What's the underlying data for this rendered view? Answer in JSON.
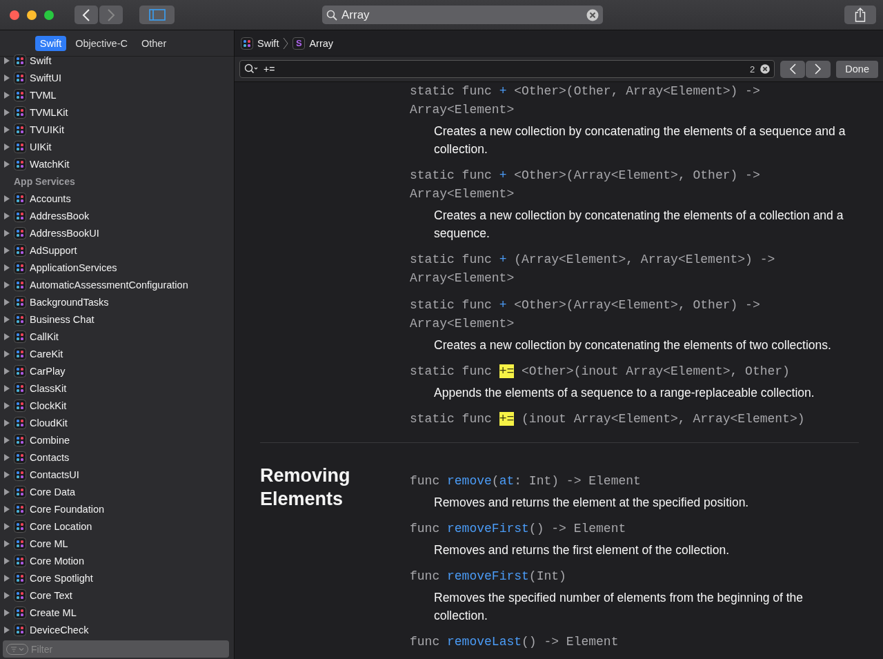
{
  "toolbar": {
    "search": {
      "value": "Array"
    }
  },
  "language_tabs": [
    {
      "label": "Swift",
      "selected": true
    },
    {
      "label": "Objective-C",
      "selected": false
    },
    {
      "label": "Other",
      "selected": false
    }
  ],
  "sidebar": {
    "items": [
      {
        "kind": "framework",
        "label": "Swift",
        "expanded": false
      },
      {
        "kind": "framework",
        "label": "SwiftUI",
        "expanded": false
      },
      {
        "kind": "framework",
        "label": "TVML",
        "expanded": false
      },
      {
        "kind": "framework",
        "label": "TVMLKit",
        "expanded": false
      },
      {
        "kind": "framework",
        "label": "TVUIKit",
        "expanded": false
      },
      {
        "kind": "framework",
        "label": "UIKit",
        "expanded": false
      },
      {
        "kind": "framework",
        "label": "WatchKit",
        "expanded": false
      },
      {
        "kind": "header",
        "label": "App Services"
      },
      {
        "kind": "framework",
        "label": "Accounts",
        "expanded": false
      },
      {
        "kind": "framework",
        "label": "AddressBook",
        "expanded": false
      },
      {
        "kind": "framework",
        "label": "AddressBookUI",
        "expanded": false
      },
      {
        "kind": "framework",
        "label": "AdSupport",
        "expanded": false
      },
      {
        "kind": "framework",
        "label": "ApplicationServices",
        "expanded": false
      },
      {
        "kind": "framework",
        "label": "AutomaticAssessmentConfiguration",
        "expanded": false
      },
      {
        "kind": "framework",
        "label": "BackgroundTasks",
        "expanded": false
      },
      {
        "kind": "framework",
        "label": "Business Chat",
        "expanded": false
      },
      {
        "kind": "framework",
        "label": "CallKit",
        "expanded": false
      },
      {
        "kind": "framework",
        "label": "CareKit",
        "expanded": false
      },
      {
        "kind": "framework",
        "label": "CarPlay",
        "expanded": false
      },
      {
        "kind": "framework",
        "label": "ClassKit",
        "expanded": false
      },
      {
        "kind": "framework",
        "label": "ClockKit",
        "expanded": false
      },
      {
        "kind": "framework",
        "label": "CloudKit",
        "expanded": false
      },
      {
        "kind": "framework",
        "label": "Combine",
        "expanded": false
      },
      {
        "kind": "framework",
        "label": "Contacts",
        "expanded": false
      },
      {
        "kind": "framework",
        "label": "ContactsUI",
        "expanded": false
      },
      {
        "kind": "framework",
        "label": "Core Data",
        "expanded": false
      },
      {
        "kind": "framework",
        "label": "Core Foundation",
        "expanded": false
      },
      {
        "kind": "framework",
        "label": "Core Location",
        "expanded": false
      },
      {
        "kind": "framework",
        "label": "Core ML",
        "expanded": false
      },
      {
        "kind": "framework",
        "label": "Core Motion",
        "expanded": false
      },
      {
        "kind": "framework",
        "label": "Core Spotlight",
        "expanded": false
      },
      {
        "kind": "framework",
        "label": "Core Text",
        "expanded": false
      },
      {
        "kind": "framework",
        "label": "Create ML",
        "expanded": false
      },
      {
        "kind": "framework",
        "label": "DeviceCheck",
        "expanded": false
      }
    ],
    "filter": {
      "placeholder": "Filter"
    }
  },
  "breadcrumb": [
    {
      "kind": "framework",
      "label": "Swift"
    },
    {
      "kind": "symbol",
      "badge": "S",
      "label": "Array"
    }
  ],
  "find_bar": {
    "value": "+=",
    "match_count": "2",
    "done": "Done"
  },
  "sections": [
    {
      "declarations": [
        {
          "code": [
            {
              "kind": "plain",
              "text": "static func "
            },
            {
              "kind": "op",
              "text": "+"
            },
            {
              "kind": "plain",
              "text": " <Other>(Other, Array<Element>) -> Array<Element>"
            }
          ],
          "description": "Creates a new collection by concatenating the elements of a sequence and a collection."
        },
        {
          "code": [
            {
              "kind": "plain",
              "text": "static func "
            },
            {
              "kind": "op",
              "text": "+"
            },
            {
              "kind": "plain",
              "text": " <Other>(Array<Element>, Other) -> Array<Element>"
            }
          ],
          "description": "Creates a new collection by concatenating the elements of a collection and a sequence."
        },
        {
          "code": [
            {
              "kind": "plain",
              "text": "static func "
            },
            {
              "kind": "op",
              "text": "+"
            },
            {
              "kind": "plain",
              "text": " (Array<Element>, Array<Element>) -> Array<Element>"
            }
          ]
        },
        {
          "code": [
            {
              "kind": "plain",
              "text": "static func "
            },
            {
              "kind": "op",
              "text": "+"
            },
            {
              "kind": "plain",
              "text": " <Other>(Array<Element>, Other) -> Array<Element>"
            }
          ],
          "description": "Creates a new collection by concatenating the elements of two collections."
        },
        {
          "code": [
            {
              "kind": "plain",
              "text": "static func "
            },
            {
              "kind": "highlight",
              "text": "+="
            },
            {
              "kind": "plain",
              "text": " <Other>(inout Array<Element>, Other)"
            }
          ],
          "description": "Appends the elements of a sequence to a range-replaceable collection."
        },
        {
          "code": [
            {
              "kind": "plain",
              "text": "static func "
            },
            {
              "kind": "highlight",
              "text": "+="
            },
            {
              "kind": "plain",
              "text": " (inout Array<Element>, Array<Element>)"
            }
          ]
        }
      ]
    },
    {
      "title": "Removing Elements",
      "declarations": [
        {
          "code": [
            {
              "kind": "plain",
              "text": "func "
            },
            {
              "kind": "name",
              "text": "remove"
            },
            {
              "kind": "plain",
              "text": "("
            },
            {
              "kind": "name",
              "text": "at"
            },
            {
              "kind": "plain",
              "text": ": Int) -> Element"
            }
          ],
          "description": "Removes and returns the element at the specified position."
        },
        {
          "code": [
            {
              "kind": "plain",
              "text": "func "
            },
            {
              "kind": "name",
              "text": "removeFirst"
            },
            {
              "kind": "plain",
              "text": "() -> Element"
            }
          ],
          "description": "Removes and returns the first element of the collection."
        },
        {
          "code": [
            {
              "kind": "plain",
              "text": "func "
            },
            {
              "kind": "name",
              "text": "removeFirst"
            },
            {
              "kind": "plain",
              "text": "(Int)"
            }
          ],
          "description": "Removes the specified number of elements from the beginning of the collection."
        },
        {
          "code": [
            {
              "kind": "plain",
              "text": "func "
            },
            {
              "kind": "name",
              "text": "removeLast"
            },
            {
              "kind": "plain",
              "text": "() -> Element"
            }
          ]
        }
      ]
    }
  ]
}
